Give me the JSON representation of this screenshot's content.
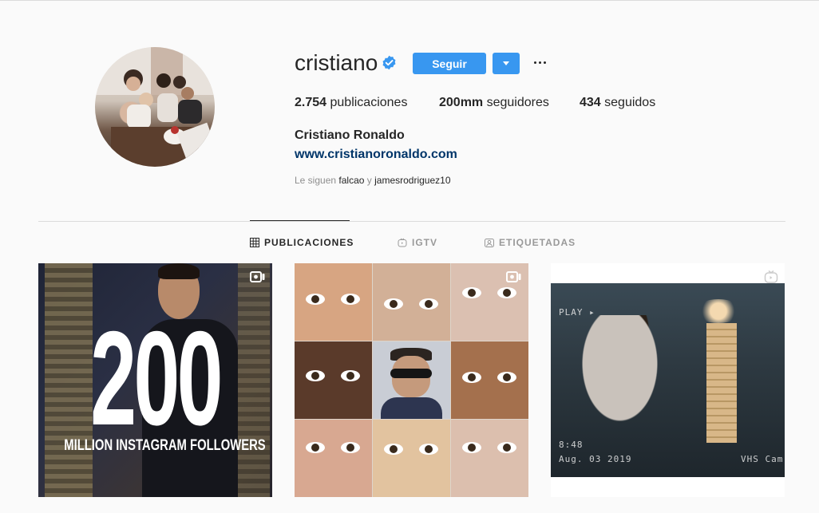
{
  "profile": {
    "username": "cristiano",
    "follow_label": "Seguir",
    "stats": {
      "posts_count": "2.754",
      "posts_label": "publicaciones",
      "followers_count": "200mm",
      "followers_label": "seguidores",
      "following_count": "434",
      "following_label": "seguidos"
    },
    "full_name": "Cristiano Ronaldo",
    "website": "www.cristianoronaldo.com",
    "followed_by": {
      "prefix": "Le siguen",
      "user1": "falcao",
      "conj": "y",
      "user2": "jamesrodriguez10"
    }
  },
  "tabs": [
    {
      "label": "PUBLICACIONES",
      "icon": "grid-icon",
      "active": true
    },
    {
      "label": "IGTV",
      "icon": "igtv-icon",
      "active": false
    },
    {
      "label": "ETIQUETADAS",
      "icon": "tagged-icon",
      "active": false
    }
  ],
  "posts": [
    {
      "type": "video",
      "overlay_big": "200",
      "overlay_sub": "MILLION INSTAGRAM FOLLOWERS"
    },
    {
      "type": "video"
    },
    {
      "type": "igtv",
      "vhs_play": "PLAY ▸",
      "vhs_time": "8:48",
      "vhs_date": "Aug. 03 2019",
      "vhs_label": "VHS Cam"
    }
  ],
  "colors": {
    "accent": "#3897f0",
    "link": "#003569",
    "muted": "#8e8e8e",
    "border": "#dbdbdb"
  }
}
